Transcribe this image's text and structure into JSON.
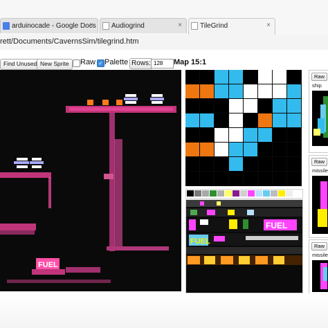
{
  "browser": {
    "tabs": [
      {
        "label": "arduinocade - Google Docs",
        "active": false,
        "icon": "google-docs-icon"
      },
      {
        "label": "Audiogrind",
        "active": false,
        "icon": "page-icon"
      },
      {
        "label": "TileGrind",
        "active": true,
        "icon": "page-icon"
      }
    ],
    "close_glyph": "×",
    "url": "rett/Documents/CavernsSim/tilegrind.htm"
  },
  "toolbar": {
    "find_unused_label": "Find Unused",
    "new_sprite_label": "New Sprite",
    "raw_label": "Raw",
    "raw_checked": false,
    "palette_label": "Palette",
    "palette_checked": true,
    "rows_label": "Rows:",
    "rows_value": "128",
    "map_label": "Map 15:1"
  },
  "palette_colors": [
    "#000000",
    "#7a7a7a",
    "#a8a8a8",
    "#2f8f2f",
    "#b0b0b0",
    "#ffff66",
    "#8b1a8b",
    "#cfcfcf",
    "#ff44ff",
    "#b8e0ff",
    "#66ccee",
    "#bdbdbd",
    "#ffee00",
    "#eeeeee",
    "#ffffff"
  ],
  "fuel_text": "FUEL",
  "sprites": [
    {
      "raw_label": "Raw",
      "name": "ship"
    },
    {
      "raw_label": "Raw",
      "name": "missile"
    },
    {
      "raw_label": "Raw",
      "name": "missile"
    }
  ],
  "tile_zoom_colors": {
    "blue": "#33bbee",
    "orange": "#ee7711",
    "white": "#ffffff",
    "black": "#000000"
  }
}
